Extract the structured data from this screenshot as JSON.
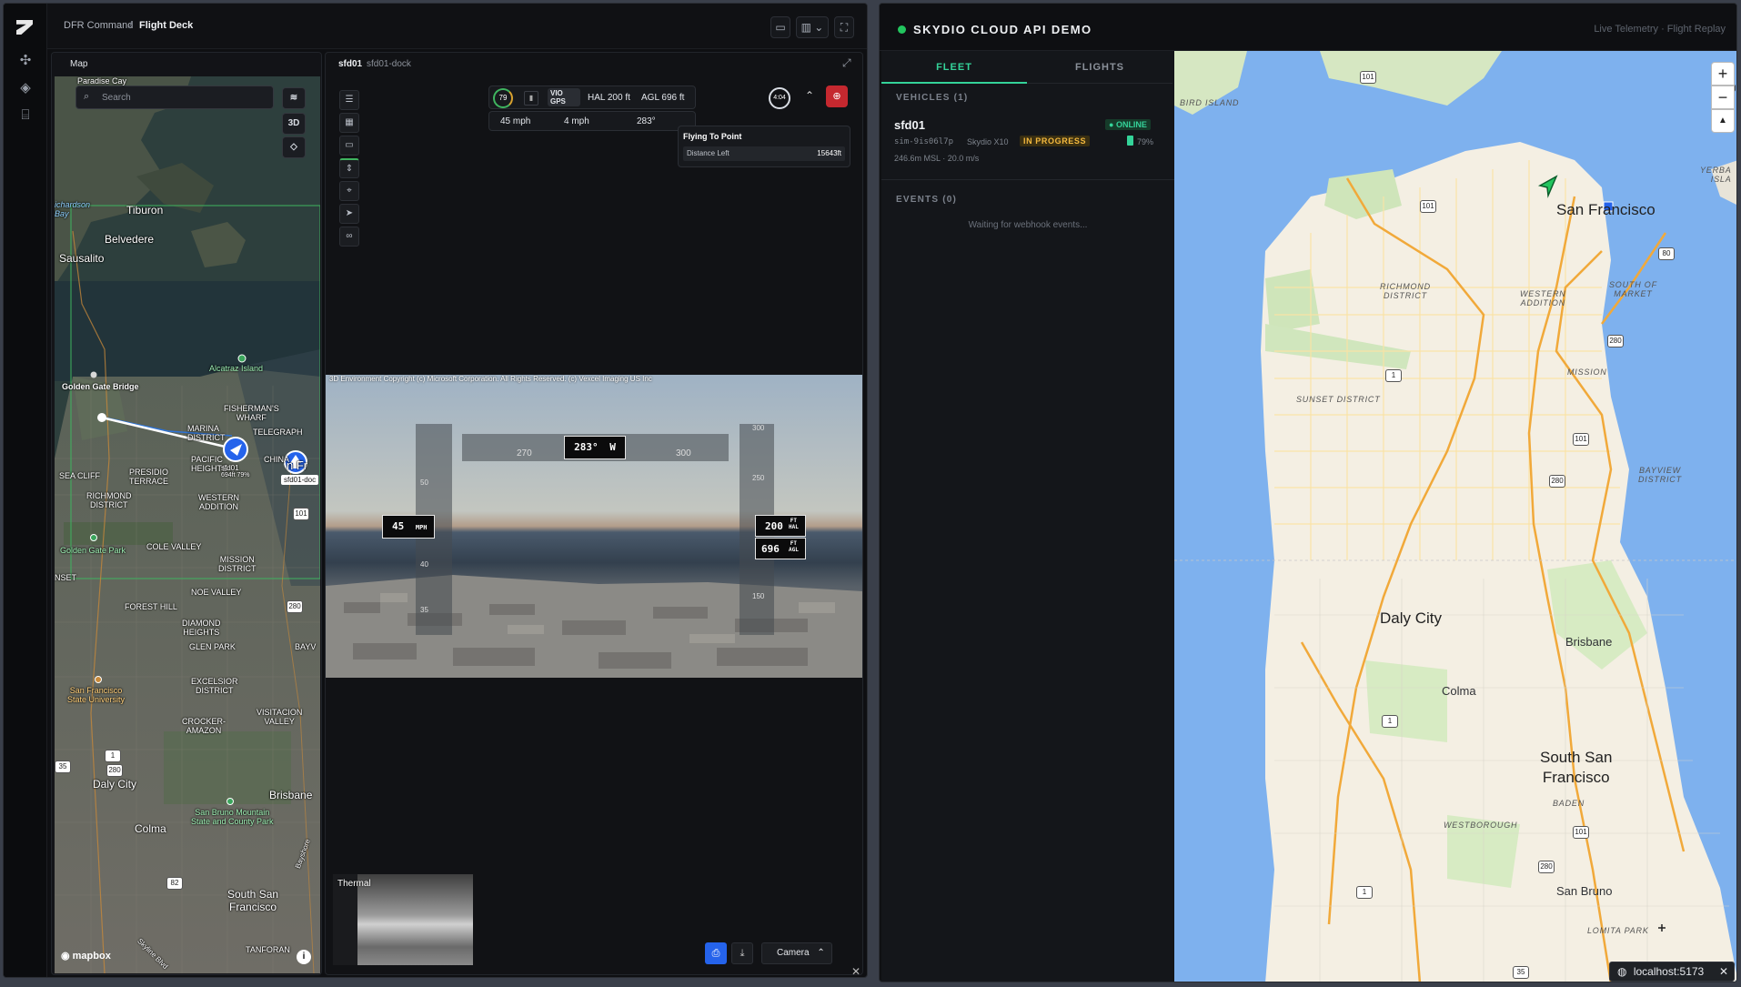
{
  "left_app": {
    "breadcrumb": {
      "root": "DFR Command",
      "separator": "/",
      "current": "Flight Deck"
    },
    "rail_icons": [
      "drone-icon",
      "waypoint-icon",
      "dock-icon"
    ],
    "header_buttons": [
      "map-view-icon",
      "layout-icon",
      "fullscreen-icon"
    ]
  },
  "map_panel": {
    "title": "Map",
    "search_placeholder": "Search",
    "controls": {
      "layers": "layers-icon",
      "three_d": "3D",
      "locate": "locate-icon"
    },
    "attribution": "mapbox",
    "labels": {
      "paradise_cay": "Paradise Cay",
      "richardson_bay": "ichardson\nBay",
      "tiburon": "Tiburon",
      "belvedere": "Belvedere",
      "sausalito": "Sausalito",
      "alcatraz": "Alcatraz Island",
      "golden_gate_bridge": "Golden Gate Bridge",
      "fishermans_wharf": "FISHERMAN'S\nWHARF",
      "marina": "MARINA\nDISTRICT",
      "telegraph": "TELEGRAPH",
      "pacific_heights": "PACIFIC\nHEIGHTS",
      "china": "CHINA",
      "presidio_terrace": "PRESIDIO\nTERRACE",
      "sea_cliff": "SEA CLIFF",
      "richmond": "RICHMOND\nDISTRICT",
      "western_addition": "WESTERN\nADDITION",
      "golden_gate_park": "Golden Gate Park",
      "cole_valley": "COLE VALLEY",
      "mission": "MISSION\nDISTRICT",
      "noe_valley": "NOE VALLEY",
      "forest_hill": "FOREST HILL",
      "diamond_heights": "DIAMOND\nHEIGHTS",
      "glen_park": "GLEN PARK",
      "bayv": "BAYV",
      "sfsu": "San Francisco\nState University",
      "excelsior": "EXCELSIOR\nDISTRICT",
      "visitacion": "VISITACION\nVALLEY",
      "crocker": "CROCKER-\nAMAZON",
      "daly_city": "Daly City",
      "brisbane": "Brisbane",
      "san_bruno_mtn": "San Bruno Mountain\nState and County Park",
      "colma": "Colma",
      "south_sf": "South San\nFrancisco",
      "tanforan": "TANFORAN",
      "skyline": "Skyline Blvd",
      "bayshore": "Bayshore",
      "nset": "NSET",
      "drone_tag": "sfd01",
      "drone_tag_sub": "694ft 79%",
      "dock_tag": "sfd01-doc",
      "sf_partial": "n Fr"
    },
    "shields": [
      "101",
      "1",
      "280",
      "35",
      "82",
      "1",
      "280"
    ]
  },
  "deck": {
    "vehicle": "sfd01",
    "dock": "sfd01-dock",
    "toolbar_icons": [
      "sliders-icon",
      "grid-icon",
      "card-icon",
      "altitude-icon",
      "pin-icon",
      "cursor-icon",
      "binoculars-icon"
    ],
    "telemetry": {
      "battery": "79",
      "battery_unit": "%",
      "signal": "signal-icon",
      "vio": "VIO",
      "gps": "GPS",
      "hal": "HAL 200 ft",
      "agl": "AGL 696 ft",
      "speed": "45 mph",
      "wind": "4 mph",
      "heading": "283°"
    },
    "timer": "4:04",
    "mission": {
      "title": "Flying To Point",
      "distance_label": "Distance Left",
      "distance_value": "15643ft"
    },
    "video": {
      "copyright": "3D Environment Copyright (c) Microsoft Corporation. All Rights Reserved. (c) Vexcel Imaging US Inc",
      "heading_readout": "283°",
      "heading_dir": "W",
      "heading_ticks": [
        "270",
        "300"
      ],
      "speed_readout": "45",
      "speed_unit": "MPH",
      "speed_ticks": [
        "50",
        "40",
        "35"
      ],
      "hal_readout": "200",
      "hal_unit_top": "FT",
      "hal_unit_bottom": "HAL",
      "agl_readout": "696",
      "agl_unit_top": "FT",
      "agl_unit_bottom": "AGL",
      "alt_ticks": [
        "300",
        "250",
        "200",
        "150"
      ]
    },
    "thermal_label": "Thermal",
    "camera_button": "Camera"
  },
  "right_app": {
    "title": "SKYDIO CLOUD API DEMO",
    "status_dot_color": "#22c55e",
    "header_right": "Live Telemetry · Flight Replay",
    "tabs": [
      "FLEET",
      "FLIGHTS"
    ],
    "vehicles_header": "VEHICLES (1)",
    "vehicle": {
      "name": "sfd01",
      "status": "ONLINE",
      "serial": "sim-9is06l7p",
      "model": "Skydio X10",
      "state": "IN PROGRESS",
      "battery": "79%",
      "details": "246.6m MSL · 20.0 m/s"
    },
    "events_header": "EVENTS (0)",
    "events_empty": "Waiting for webhook events...",
    "map": {
      "bird_island": "BIRD ISLAND",
      "san_francisco": "San Francisco",
      "richmond": "RICHMOND\nDISTRICT",
      "western_addition": "WESTERN\nADDITION",
      "south_of_market": "SOUTH OF\nMARKET",
      "mission": "MISSION",
      "sunset": "SUNSET DISTRICT",
      "bayview": "BAYVIEW\nDISTRICT",
      "daly_city": "Daly City",
      "brisbane": "Brisbane",
      "colma": "Colma",
      "south_sf": "South San\nFrancisco",
      "baden": "BADEN",
      "westborough": "WESTBOROUGH",
      "san_bruno": "San Bruno",
      "lomita": "LOMITA PARK",
      "yerba": "YERBA\nISLA",
      "u_edge": "U",
      "zoom_in": "+",
      "zoom_out": "−",
      "compass": "▲",
      "shields": [
        "101",
        "101",
        "80",
        "1",
        "280",
        "101",
        "280",
        "1",
        "101",
        "280",
        "1",
        "35"
      ]
    },
    "localhost": "localhost:5173"
  }
}
